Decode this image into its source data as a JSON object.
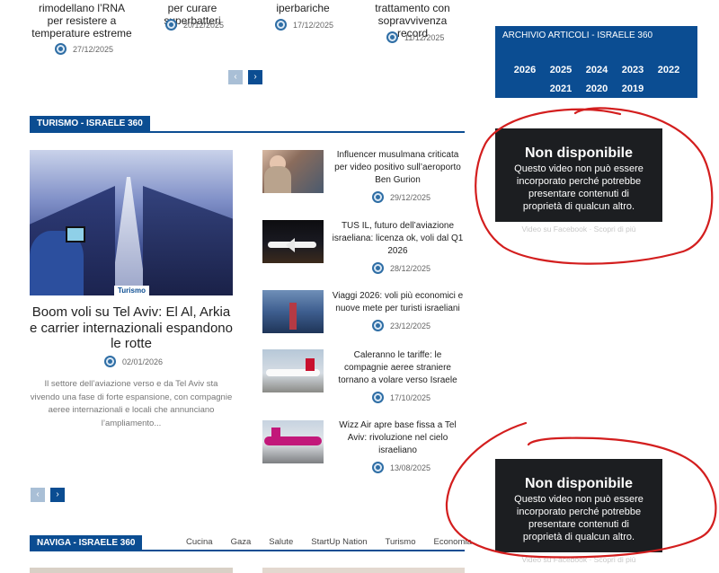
{
  "top_articles": [
    {
      "title": "rimodellano l’RNA per resistere a temperature estreme",
      "date": "27/12/2025"
    },
    {
      "title": "per curare superbatteri",
      "date": "20/12/2025"
    },
    {
      "title": "iperbariche",
      "date": "17/12/2025"
    },
    {
      "title": "trattamento con sopravvivenza record",
      "date": "11/12/2025"
    }
  ],
  "pager": {
    "prev": "‹",
    "next": "›"
  },
  "turismo": {
    "section_title": "TURISMO - ISRAELE 360",
    "main": {
      "tag": "Turismo",
      "title": "Boom voli su Tel Aviv: El Al, Arkia e carrier internazionali espandono le rotte",
      "date": "02/01/2026",
      "excerpt": "Il settore dell’aviazione verso e da Tel Aviv sta vivendo una fase di forte espansione, con compagnie aeree internazionali e locali che annunciano l’ampliamento..."
    },
    "items": [
      {
        "title": "Influencer musulmana criticata per video positivo sull’aeroporto Ben Gurion",
        "date": "29/12/2025"
      },
      {
        "title": "TUS IL, futuro dell’aviazione israeliana: licenza ok, voli dal Q1 2026",
        "date": "28/12/2025"
      },
      {
        "title": "Viaggi 2026: voli più economici e nuove mete per turisti israeliani",
        "date": "23/12/2025"
      },
      {
        "title": "Caleranno le tariffe: le compagnie aeree straniere tornano a volare verso Israele",
        "date": "17/10/2025"
      },
      {
        "title": "Wizz Air apre base fissa a Tel Aviv: rivoluzione nel cielo israeliano",
        "date": "13/08/2025"
      }
    ]
  },
  "archive": {
    "title": "ARCHIVIO ARTICOLI - ISRAELE 360",
    "years_row1": [
      "2026",
      "2025",
      "2024",
      "2023",
      "2022"
    ],
    "years_row2": [
      "2021",
      "2020",
      "2019"
    ]
  },
  "fb_video": {
    "heading": "Non disponibile",
    "message": "Questo video non può essere incorporato perché potrebbe presentare contenuti di proprietà di qualcun altro.",
    "footer": "Video su Facebook · Scopri di più"
  },
  "naviga": {
    "section_title": "NAVIGA - ISRAELE 360",
    "tabs": [
      "Cucina",
      "Gaza",
      "Salute",
      "StartUp Nation",
      "Turismo",
      "Economia"
    ]
  },
  "colors": {
    "brand_blue": "#0b4d92",
    "annotation_red": "#d31e1e"
  }
}
